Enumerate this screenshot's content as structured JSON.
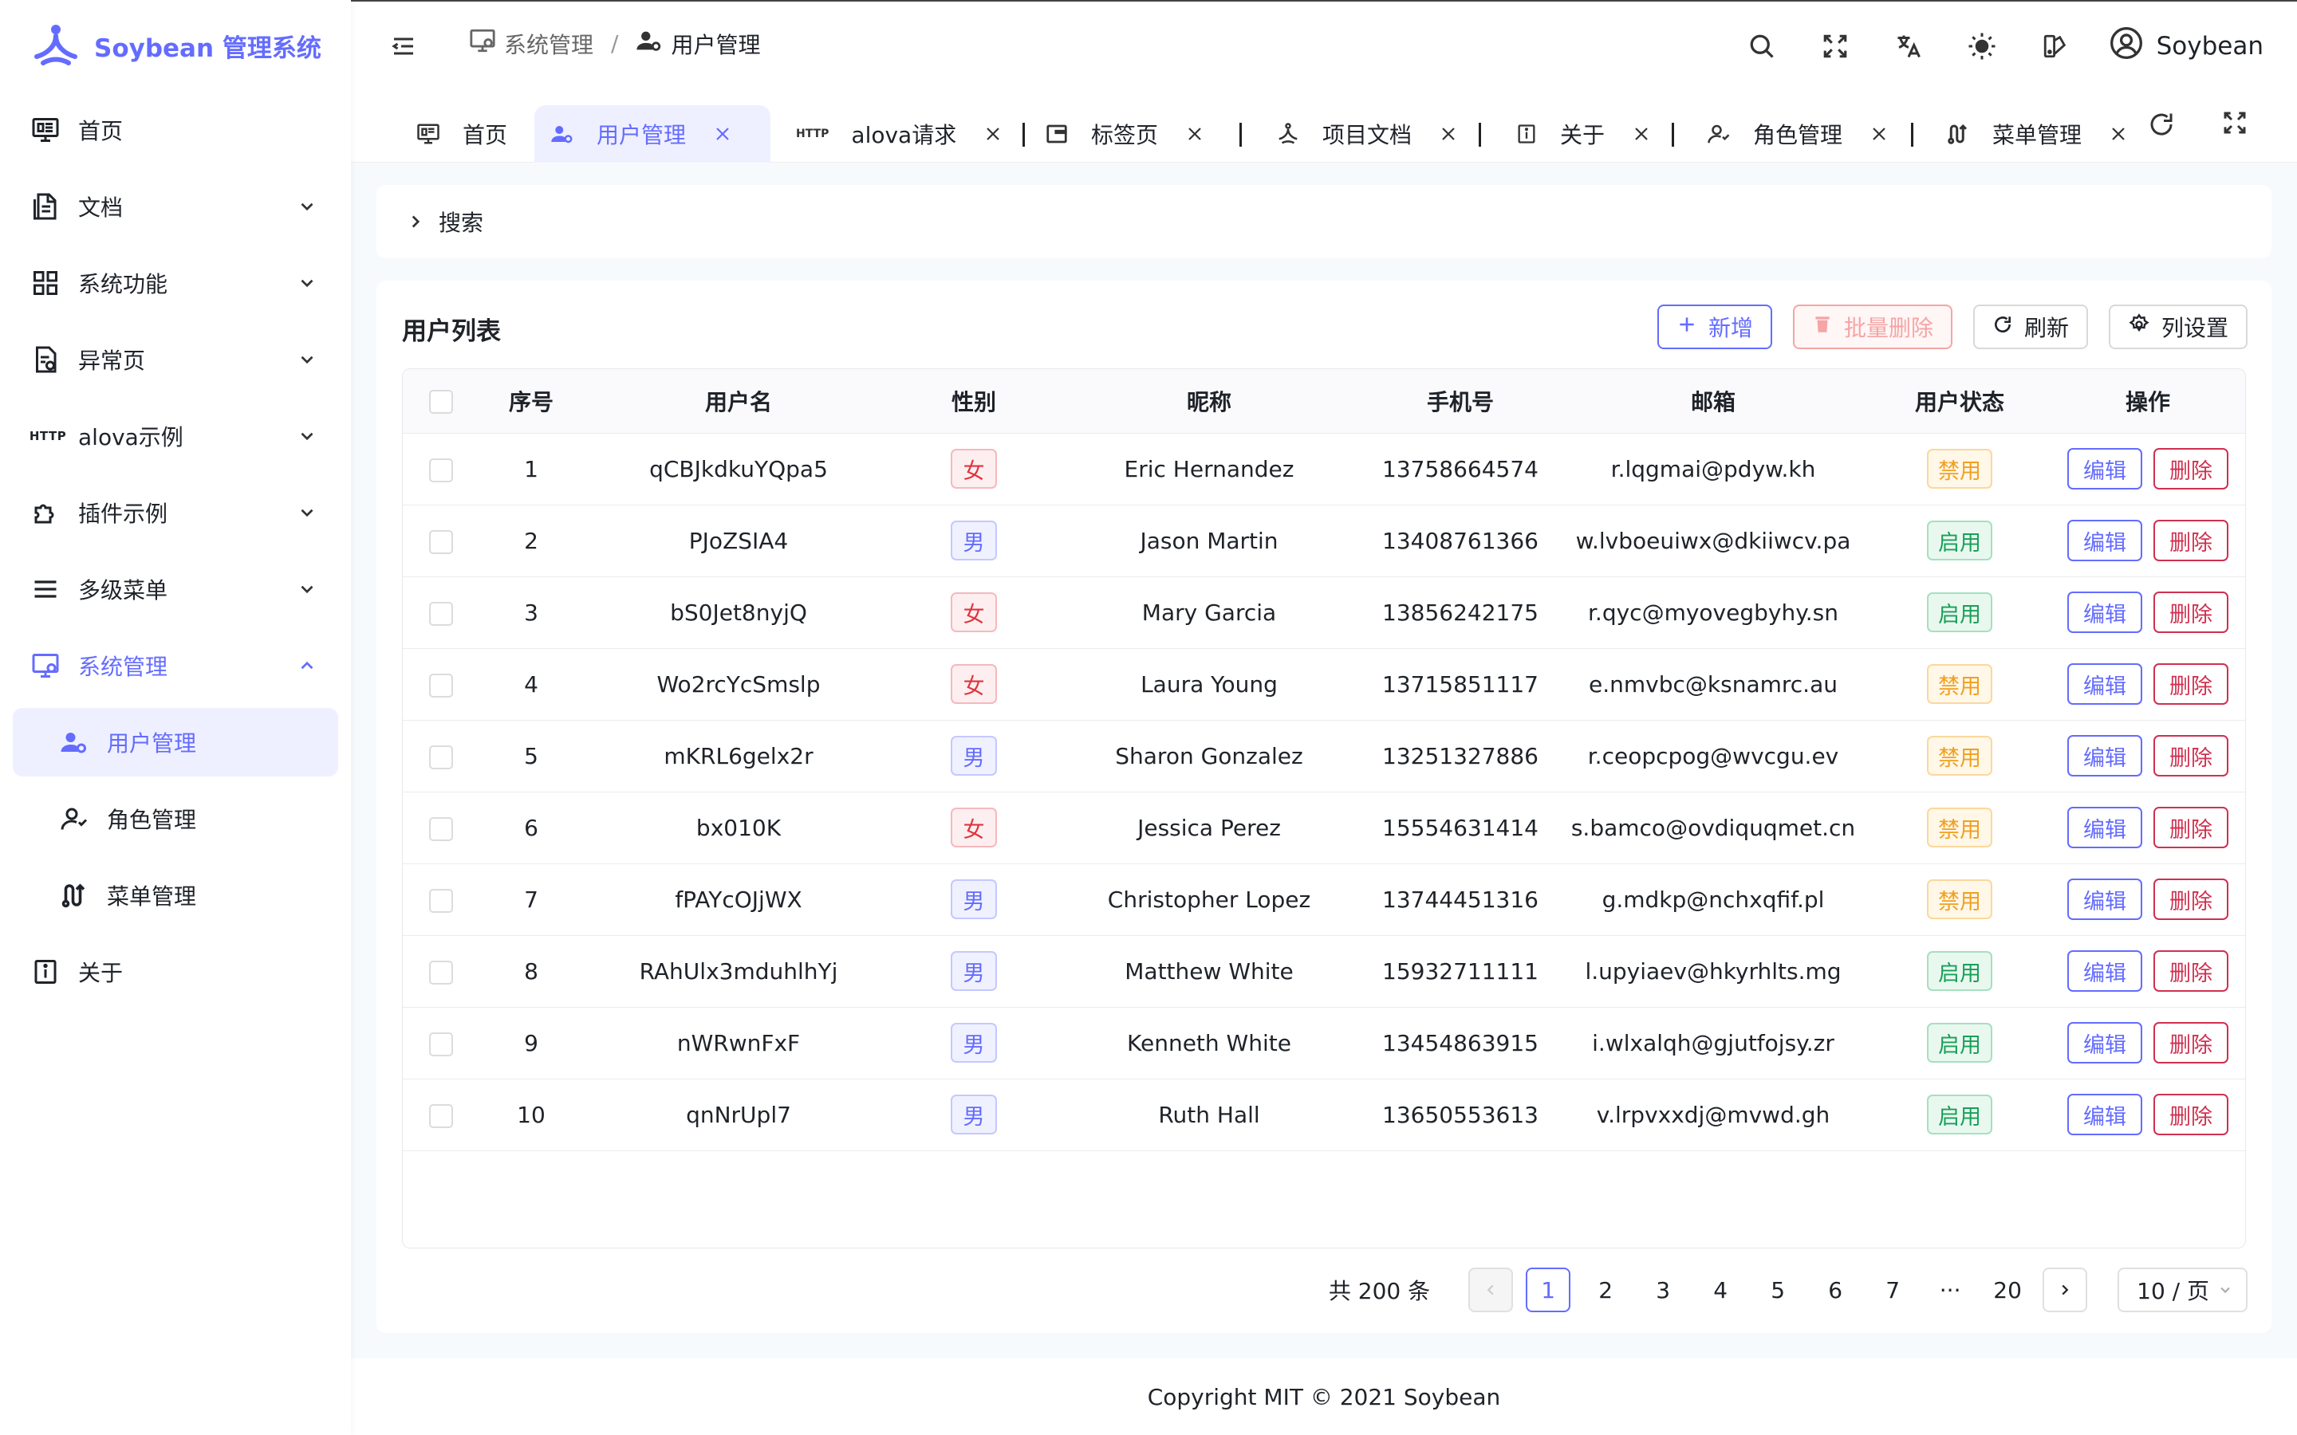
{
  "app": {
    "logo_text": "Soybean 管理系统",
    "brand_color": "#646cff"
  },
  "sidebar": {
    "items": [
      {
        "label": "首页",
        "icon": "monitor-dashboard-icon"
      },
      {
        "label": "文档",
        "icon": "document-icon"
      },
      {
        "label": "系统功能",
        "icon": "grid-icon"
      },
      {
        "label": "异常页",
        "icon": "file-alert-icon"
      },
      {
        "label": "alova示例",
        "icon": "http-icon",
        "icon_text": "HTTP"
      },
      {
        "label": "插件示例",
        "icon": "puzzle-icon"
      },
      {
        "label": "多级菜单",
        "icon": "menu-lines-icon"
      },
      {
        "label": "系统管理",
        "icon": "monitor-gear-icon"
      },
      {
        "label": "用户管理",
        "icon": "user-gear-icon"
      },
      {
        "label": "角色管理",
        "icon": "user-outline-icon"
      },
      {
        "label": "菜单管理",
        "icon": "route-icon"
      },
      {
        "label": "关于",
        "icon": "info-icon"
      }
    ]
  },
  "header": {
    "breadcrumb": [
      {
        "label": "系统管理",
        "icon": "monitor-gear-icon"
      },
      {
        "label": "用户管理",
        "icon": "user-gear-icon"
      }
    ],
    "separator": "/",
    "username": "Soybean"
  },
  "tabs": [
    {
      "label": "首页",
      "icon": "monitor-dashboard-icon"
    },
    {
      "label": "用户管理",
      "icon": "user-gear-icon"
    },
    {
      "label": "alova请求",
      "icon": "http-icon",
      "icon_text": "HTTP"
    },
    {
      "label": "标签页",
      "icon": "window-icon"
    },
    {
      "label": "项目文档",
      "icon": "logo-icon"
    },
    {
      "label": "关于",
      "icon": "info-icon"
    },
    {
      "label": "角色管理",
      "icon": "user-outline-icon"
    },
    {
      "label": "菜单管理",
      "icon": "route-icon"
    }
  ],
  "search": {
    "label": "搜索"
  },
  "table": {
    "title": "用户列表",
    "actions": {
      "add": "新增",
      "batch_delete": "批量删除",
      "refresh": "刷新",
      "columns": "列设置"
    },
    "columns": [
      "序号",
      "用户名",
      "性别",
      "昵称",
      "手机号",
      "邮箱",
      "用户状态",
      "操作"
    ],
    "row_actions": {
      "edit": "编辑",
      "delete": "删除"
    },
    "rows": [
      {
        "index": "1",
        "username": "qCBJkdkuYQpa5",
        "gender": "女",
        "gender_type": "female",
        "nickname": "Eric Hernandez",
        "phone": "13758664574",
        "email": "r.lqgmai@pdyw.kh",
        "status": "禁用",
        "status_type": "off"
      },
      {
        "index": "2",
        "username": "PJoZSIA4",
        "gender": "男",
        "gender_type": "male",
        "nickname": "Jason Martin",
        "phone": "13408761366",
        "email": "w.lvboeuiwx@dkiiwcv.pa",
        "status": "启用",
        "status_type": "on"
      },
      {
        "index": "3",
        "username": "bS0Jet8nyjQ",
        "gender": "女",
        "gender_type": "female",
        "nickname": "Mary Garcia",
        "phone": "13856242175",
        "email": "r.qyc@myovegbyhy.sn",
        "status": "启用",
        "status_type": "on"
      },
      {
        "index": "4",
        "username": "Wo2rcYcSmslp",
        "gender": "女",
        "gender_type": "female",
        "nickname": "Laura Young",
        "phone": "13715851117",
        "email": "e.nmvbc@ksnamrc.au",
        "status": "禁用",
        "status_type": "off"
      },
      {
        "index": "5",
        "username": "mKRL6gelx2r",
        "gender": "男",
        "gender_type": "male",
        "nickname": "Sharon Gonzalez",
        "phone": "13251327886",
        "email": "r.ceopcpog@wvcgu.ev",
        "status": "禁用",
        "status_type": "off"
      },
      {
        "index": "6",
        "username": "bx010K",
        "gender": "女",
        "gender_type": "female",
        "nickname": "Jessica Perez",
        "phone": "15554631414",
        "email": "s.bamco@ovdiquqmet.cn",
        "status": "禁用",
        "status_type": "off"
      },
      {
        "index": "7",
        "username": "fPAYcOJjWX",
        "gender": "男",
        "gender_type": "male",
        "nickname": "Christopher Lopez",
        "phone": "13744451316",
        "email": "g.mdkp@nchxqfif.pl",
        "status": "禁用",
        "status_type": "off"
      },
      {
        "index": "8",
        "username": "RAhUlx3mduhlhYj",
        "gender": "男",
        "gender_type": "male",
        "nickname": "Matthew White",
        "phone": "15932711111",
        "email": "l.upyiaev@hkyrhlts.mg",
        "status": "启用",
        "status_type": "on"
      },
      {
        "index": "9",
        "username": "nWRwnFxF",
        "gender": "男",
        "gender_type": "male",
        "nickname": "Kenneth White",
        "phone": "13454863915",
        "email": "i.wlxalqh@gjutfojsy.zr",
        "status": "启用",
        "status_type": "on"
      },
      {
        "index": "10",
        "username": "qnNrUpl7",
        "gender": "男",
        "gender_type": "male",
        "nickname": "Ruth Hall",
        "phone": "13650553613",
        "email": "v.lrpvxxdj@mvwd.gh",
        "status": "启用",
        "status_type": "on"
      }
    ]
  },
  "pagination": {
    "total": "共 200 条",
    "pages": [
      "1",
      "2",
      "3",
      "4",
      "5",
      "6",
      "7"
    ],
    "ellipsis": "···",
    "last": "20",
    "current": "1",
    "page_size": "10 / 页"
  },
  "footer": {
    "text": "Copyright MIT © 2021 Soybean"
  }
}
